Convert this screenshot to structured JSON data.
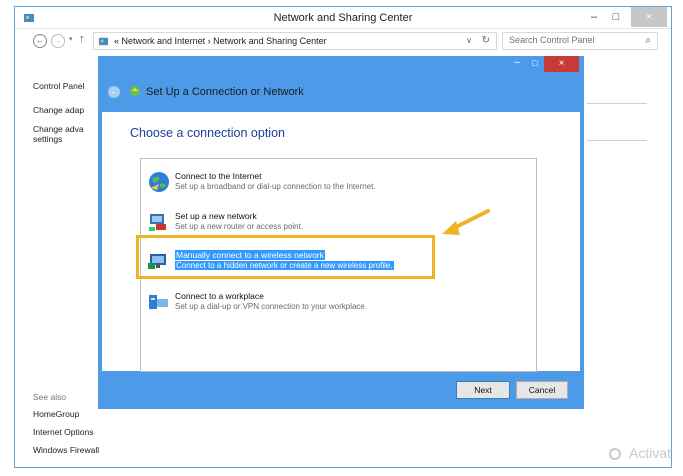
{
  "window": {
    "title": "Network and Sharing Center",
    "minimize": "–",
    "maximize": "□",
    "close": "×"
  },
  "address_bar": {
    "back": "←",
    "forward": "→",
    "recent": "▾",
    "up": "↑",
    "crumb_prefix": "«",
    "crumbs": [
      "Network and Internet",
      "Network and Sharing Center"
    ],
    "separator": "›",
    "dropdown": "∨",
    "refresh": "↻",
    "search_placeholder": "Search Control Panel",
    "search_icon": "⌕"
  },
  "sidebar": {
    "links": [
      "Control Panel",
      "Change adap",
      "Change adva",
      "settings"
    ],
    "see_also": "See also",
    "see_also_links": [
      "HomeGroup",
      "Internet Options",
      "Windows Firewall"
    ]
  },
  "watermark": "Activat",
  "dialog": {
    "title": "Set Up a Connection or Network",
    "heading": "Choose a connection option",
    "minimize": "–",
    "maximize": "□",
    "close": "×",
    "back": "←",
    "options": [
      {
        "title": "Connect to the Internet",
        "desc": "Set up a broadband or dial-up connection to the Internet.",
        "icon": "globe-icon"
      },
      {
        "title": "Set up a new network",
        "desc": "Set up a new router or access point.",
        "icon": "router-icon"
      },
      {
        "title": "Manually connect to a wireless network",
        "desc": "Connect to a hidden network or create a new wireless profile.",
        "icon": "wireless-monitor-icon",
        "selected": true
      },
      {
        "title": "Connect to a workplace",
        "desc": "Set up a dial-up or VPN connection to your workplace.",
        "icon": "workplace-icon"
      }
    ],
    "next_label": "Next",
    "cancel_label": "Cancel"
  },
  "colors": {
    "dialog_frame": "#4d9be8",
    "selection": "#3399ff",
    "highlight_box": "#f0b323",
    "arrow": "#f0b323",
    "heading": "#1e3f9a"
  }
}
